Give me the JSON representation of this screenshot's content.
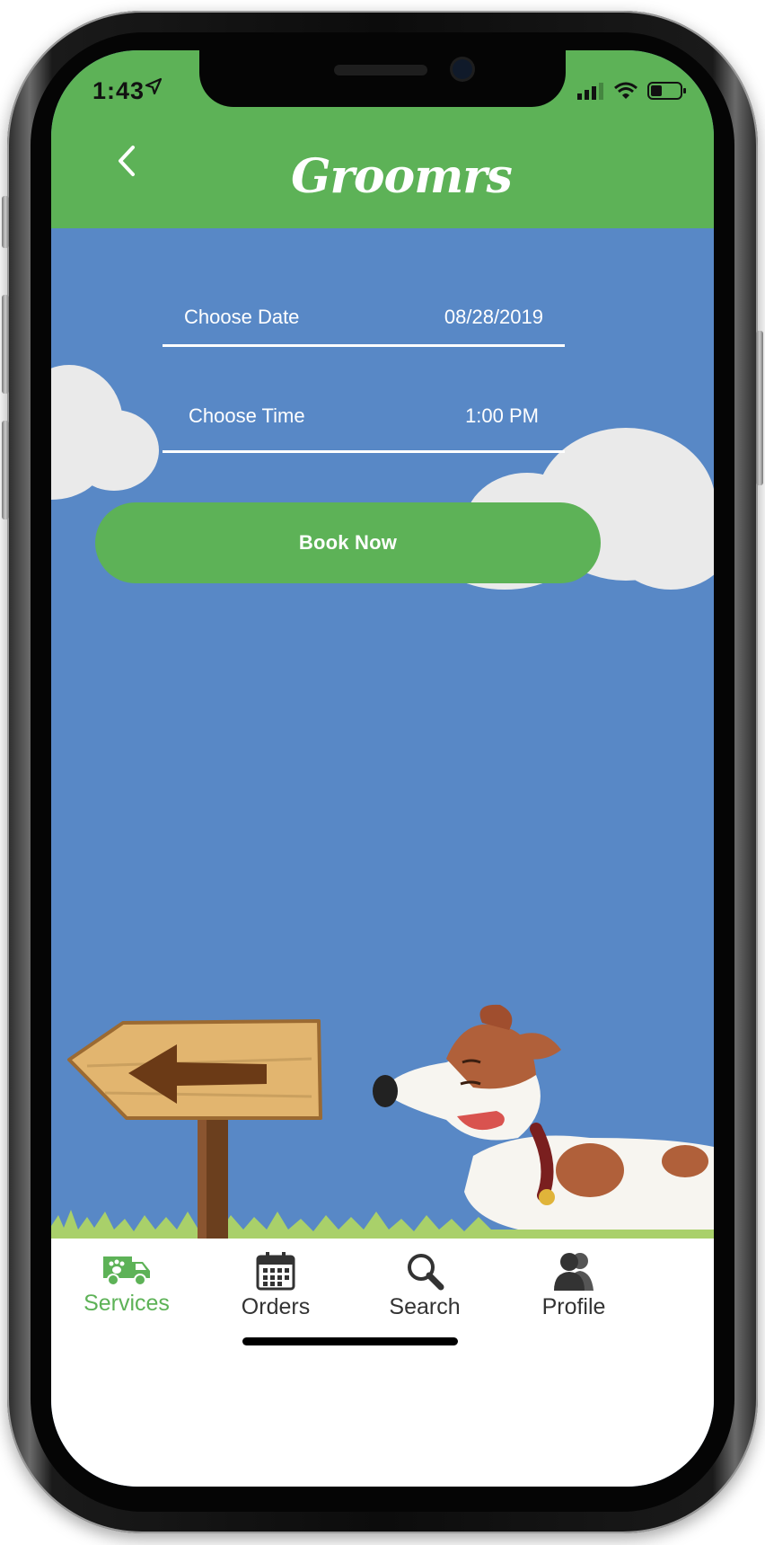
{
  "status_bar": {
    "time": "1:43"
  },
  "header": {
    "logo": "Groomrs",
    "back_icon": "chevron-left-icon"
  },
  "booking": {
    "date_label": "Choose Date",
    "date_value": "08/28/2019",
    "time_label": "Choose Time",
    "time_value": "1:00 PM",
    "book_button": "Book Now"
  },
  "tabs": [
    {
      "label": "Services",
      "icon": "van-icon",
      "active": true
    },
    {
      "label": "Orders",
      "icon": "calendar-icon",
      "active": false
    },
    {
      "label": "Search",
      "icon": "search-icon",
      "active": false
    },
    {
      "label": "Profile",
      "icon": "profile-icon",
      "active": false
    }
  ],
  "colors": {
    "accent_green": "#5db257",
    "background_blue": "#5888c6"
  }
}
